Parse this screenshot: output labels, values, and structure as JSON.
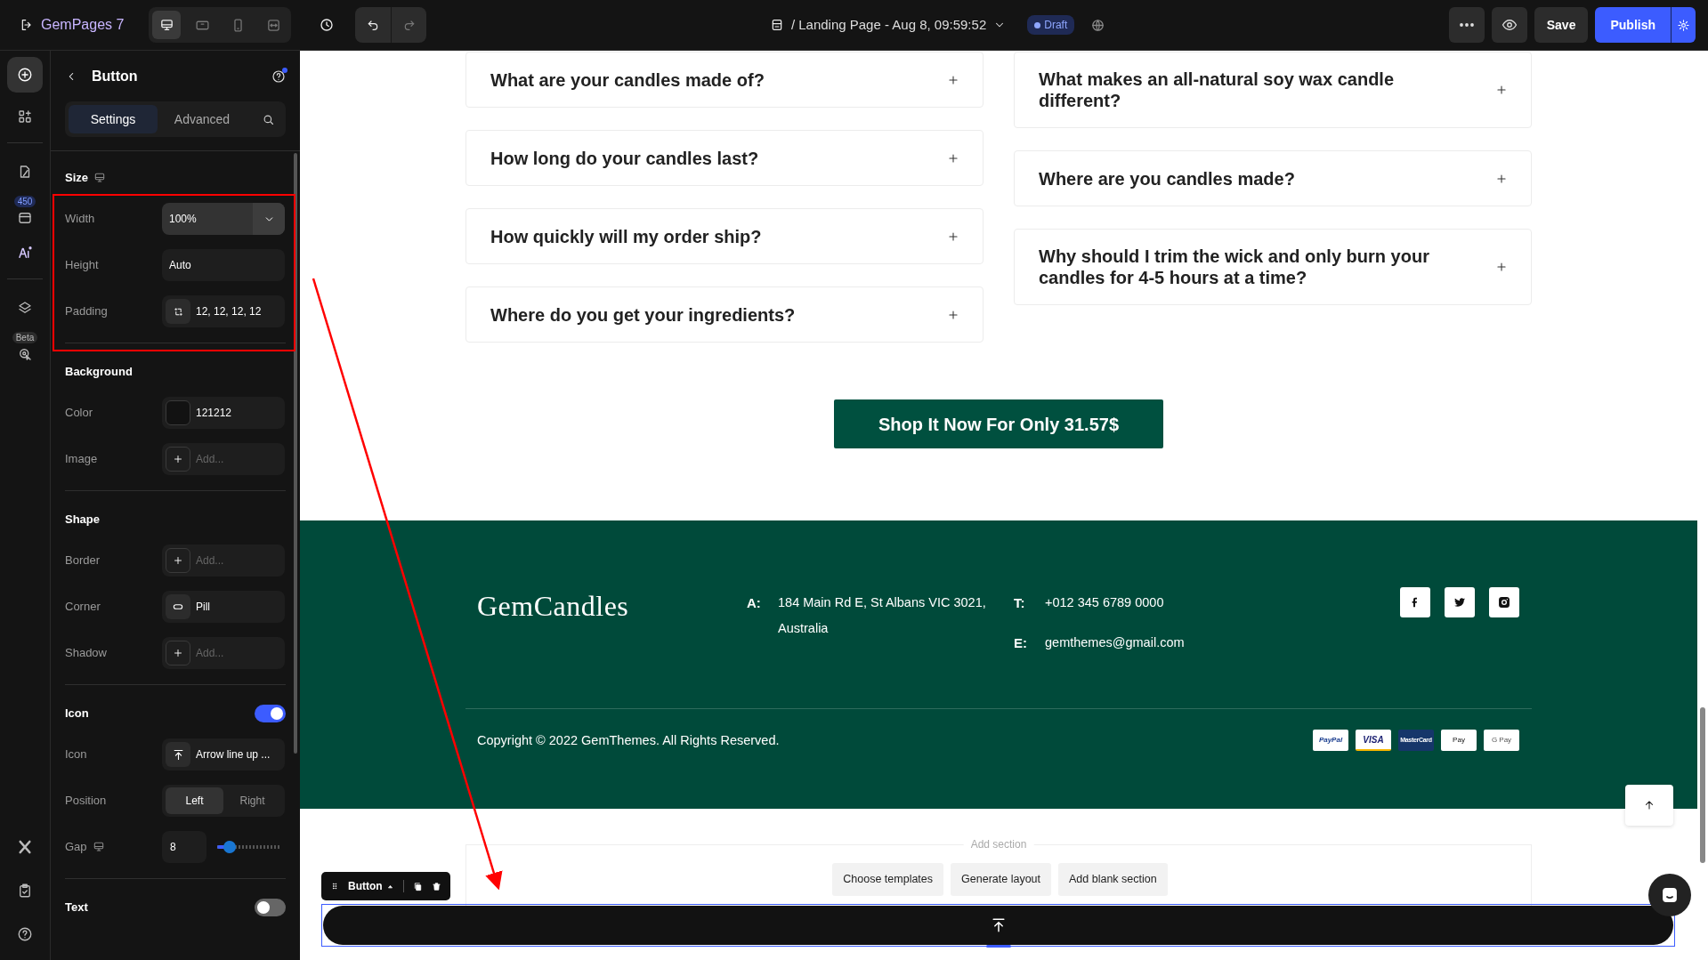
{
  "topbar": {
    "brand": "GemPages 7",
    "devices": [
      {
        "kind": "desktop",
        "selected": true
      },
      {
        "kind": "tablet",
        "selected": false
      },
      {
        "kind": "mobile",
        "selected": false
      },
      {
        "kind": "fit",
        "selected": false
      }
    ],
    "page_title": "/ Landing Page - Aug 8, 09:59:52",
    "status": "Draft",
    "save": "Save",
    "publish": "Publish"
  },
  "rail": {
    "items": [
      {
        "kind": "add",
        "selected": true
      },
      {
        "kind": "elements",
        "selected": false
      },
      {
        "kind": "pages",
        "selected": false
      },
      {
        "kind": "sections",
        "selected": false,
        "badge": "450"
      },
      {
        "kind": "ai",
        "selected": false
      },
      {
        "kind": "layers",
        "selected": false
      },
      {
        "kind": "tool",
        "selected": false,
        "badge": "Beta"
      }
    ],
    "bottom": [
      {
        "kind": "x"
      },
      {
        "kind": "checklist"
      },
      {
        "kind": "help"
      }
    ]
  },
  "panel": {
    "title": "Button",
    "tabs": [
      {
        "label": "Settings",
        "selected": true
      },
      {
        "label": "Advanced",
        "selected": false
      }
    ],
    "sections": [
      {
        "title": "Size",
        "device_icon": true,
        "rows": [
          {
            "kind": "select",
            "label": "Width",
            "value": "100%"
          },
          {
            "kind": "input",
            "label": "Height",
            "value": "Auto"
          },
          {
            "kind": "padding",
            "label": "Padding",
            "value": "12, 12, 12, 12"
          }
        ]
      },
      {
        "title": "Background",
        "rows": [
          {
            "kind": "color",
            "label": "Color",
            "value": "121212"
          },
          {
            "kind": "add",
            "label": "Image",
            "placeholder": "Add..."
          }
        ]
      },
      {
        "title": "Shape",
        "rows": [
          {
            "kind": "add",
            "label": "Border",
            "placeholder": "Add..."
          },
          {
            "kind": "corner",
            "label": "Corner",
            "value": "Pill"
          },
          {
            "kind": "add",
            "label": "Shadow",
            "placeholder": "Add..."
          }
        ]
      },
      {
        "title": "Icon",
        "toggle": {
          "on": true
        },
        "rows": [
          {
            "kind": "icon",
            "label": "Icon",
            "value": "Arrow line up ..."
          },
          {
            "kind": "segmented",
            "label": "Position",
            "options": [
              {
                "label": "Left",
                "selected": true
              },
              {
                "label": "Right",
                "selected": false
              }
            ]
          },
          {
            "kind": "slider",
            "label": "Gap",
            "device_icon": true,
            "value": "8",
            "level": 0.2
          }
        ]
      },
      {
        "title": "Text",
        "toggle": {
          "on": false
        }
      }
    ]
  },
  "faq": {
    "columns": [
      [
        {
          "question": "What are your candles made of?"
        },
        {
          "question": "How long do your candles last?"
        },
        {
          "question": "How quickly will my order ship?"
        },
        {
          "question": "Where do you get your ingredients?"
        }
      ],
      [
        {
          "question": "What makes an all-natural soy wax candle different?"
        },
        {
          "question": "Where are you candles made?"
        },
        {
          "question": "Why should I trim the wick and only burn your candles for 4-5 hours at a time?"
        }
      ]
    ]
  },
  "cta": "Shop It Now For Only 31.57$",
  "footer": {
    "logo": "GemCandles",
    "address": {
      "label": "A:",
      "value": "184 Main Rd E, St Albans VIC 3021, Australia"
    },
    "contacts": [
      {
        "label": "T:",
        "value": "+012 345 6789 0000"
      },
      {
        "label": "E:",
        "value": "gemthemes@gmail.com"
      }
    ],
    "socials": [
      {
        "kind": "facebook"
      },
      {
        "kind": "twitter"
      },
      {
        "kind": "instagram"
      }
    ],
    "copyright": "Copyright © 2022 GemThemes. All Rights Reserved.",
    "payments": [
      {
        "kind": "paypal",
        "label": "PayPal"
      },
      {
        "kind": "visa",
        "label": "VISA"
      },
      {
        "kind": "mastercard",
        "label": "MasterCard"
      },
      {
        "kind": "applepay",
        "label": "Pay"
      },
      {
        "kind": "gpay",
        "label": "G Pay"
      }
    ]
  },
  "add_section": {
    "title": "Add section",
    "options": [
      "Choose templates",
      "Generate layout",
      "Add blank section"
    ]
  },
  "selected_element": {
    "label": "Button"
  }
}
